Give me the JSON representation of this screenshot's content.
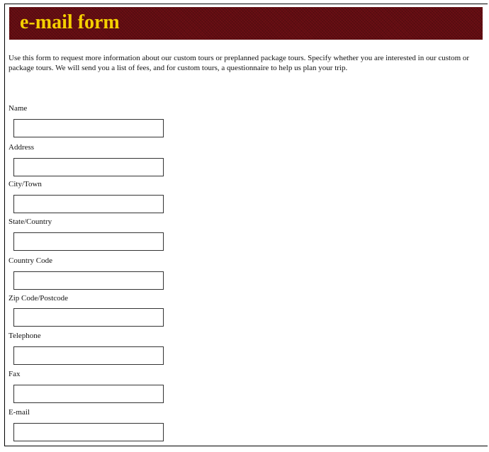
{
  "header": {
    "title": "e-mail form"
  },
  "intro": {
    "text": "Use this form to request more information about our custom tours or preplanned package tours. Specify whether you are interested in our custom or package tours. We will send you a list of fees, and for custom tours, a questionnaire to help us plan your trip."
  },
  "form": {
    "fields": [
      {
        "label": "Name",
        "value": ""
      },
      {
        "label": "Address",
        "value": ""
      },
      {
        "label": "City/Town",
        "value": ""
      },
      {
        "label": "State/Country",
        "value": ""
      },
      {
        "label": "Country Code",
        "value": ""
      },
      {
        "label": "Zip Code/Postcode",
        "value": ""
      },
      {
        "label": "Telephone",
        "value": ""
      },
      {
        "label": "Fax",
        "value": ""
      },
      {
        "label": "E-mail",
        "value": ""
      }
    ]
  },
  "colors": {
    "banner_bg": "#6b0f14",
    "banner_text": "#f5d000",
    "text": "#111111"
  }
}
